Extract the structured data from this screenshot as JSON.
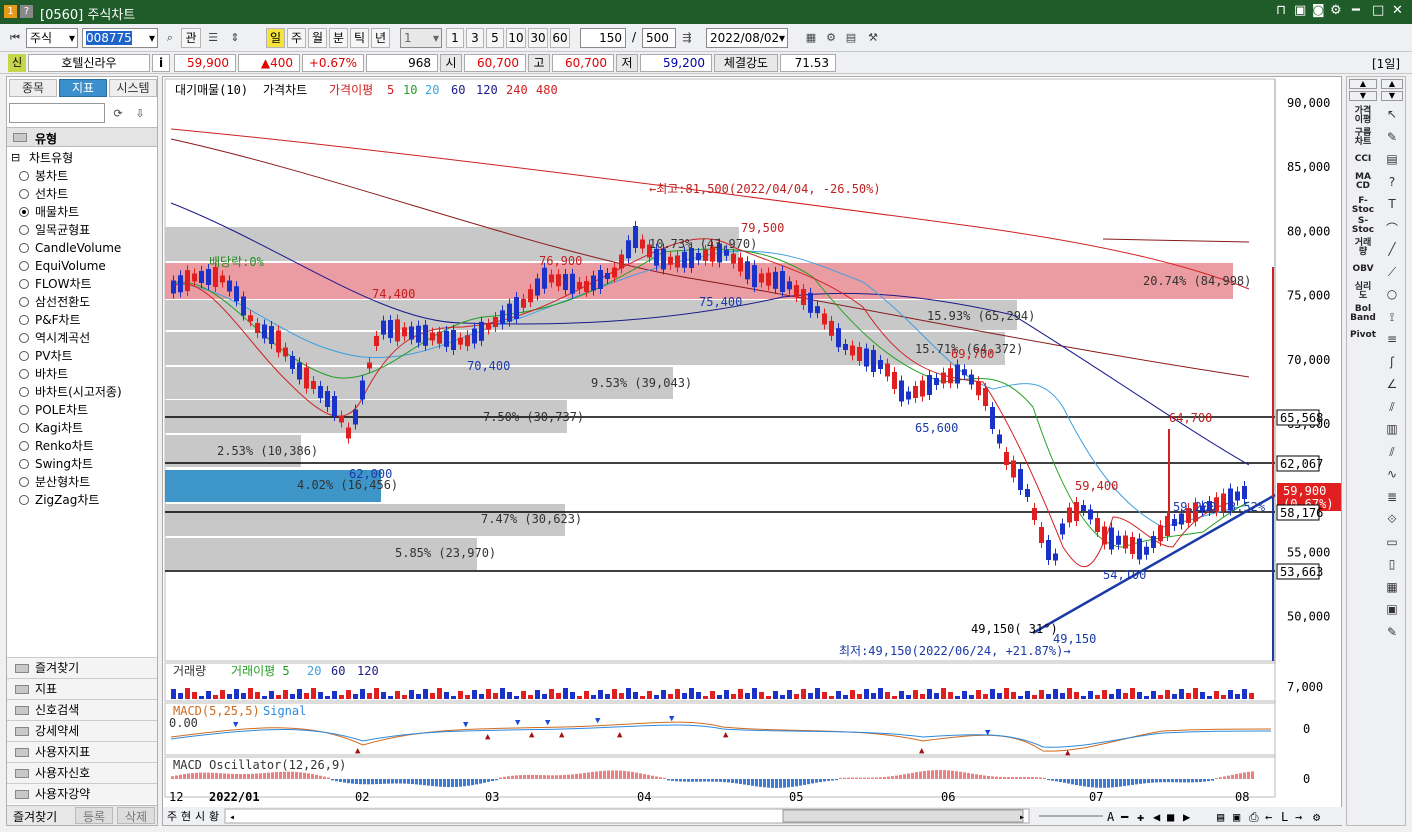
{
  "window": {
    "title": "[0560] 주식차트"
  },
  "toolbar": {
    "market": "주식",
    "code": "008775",
    "btn_gwan": "관",
    "periods": [
      "일",
      "주",
      "월",
      "분",
      "틱",
      "년"
    ],
    "interval": "1",
    "quick": [
      "1",
      "3",
      "5",
      "10",
      "30",
      "60"
    ],
    "count": "150",
    "slash": "/",
    "max": "500",
    "date": "2022/08/02"
  },
  "quote": {
    "badge": "신",
    "name": "호텔신라우",
    "info": "i",
    "price": "59,900",
    "change": "▲400",
    "rate": "+0.67%",
    "volume": "968",
    "open_label": "시",
    "open": "60,700",
    "high_label": "고",
    "high": "60,700",
    "low_label": "저",
    "low": "59,200",
    "strength_label": "체결강도",
    "strength": "71.53",
    "period_tag": "[1일]"
  },
  "left": {
    "tabs": [
      "종목",
      "지표",
      "시스템"
    ],
    "section": "유형",
    "tree_root": "차트유형",
    "types": [
      "봉차트",
      "선차트",
      "매물차트",
      "일목균형표",
      "CandleVolume",
      "EquiVolume",
      "FLOW차트",
      "삼선전환도",
      "P&F차트",
      "역시계곡선",
      "PV차트",
      "바차트",
      "바차트(시고저종)",
      "POLE차트",
      "Kagi차트",
      "Renko차트",
      "Swing차트",
      "분산형차트",
      "ZigZag차트"
    ],
    "selected_type": "매물차트",
    "folders": [
      "즐겨찾기",
      "지표",
      "신호검색",
      "강세약세",
      "사용자지표",
      "사용자신호",
      "사용자강약"
    ],
    "bottom_tabs": [
      "즐겨찾기",
      "등록",
      "삭제"
    ]
  },
  "chart": {
    "legend": {
      "vp": "대기매물(10)",
      "price": "가격차트",
      "ma": "가격이평",
      "ma_periods": [
        "5",
        "10",
        "20",
        "60",
        "120",
        "240",
        "480"
      ]
    },
    "y_labels": [
      "90,000",
      "85,000",
      "80,000",
      "75,000",
      "70,000",
      "65,000",
      "60,000",
      "55,000",
      "50,000"
    ],
    "price_tags": {
      "l1": "65,568",
      "l2": "62,067",
      "current": "59,900",
      "current_pct": "(0.67%)",
      "l3": "58,176",
      "l4": "53,663"
    },
    "vp_labels": [
      "20.74% (84,998)",
      "15.93% (65,294)",
      "15.71% (64,372)",
      "10.73% (43,970)",
      "9.53% (39,043)",
      "7.50% (30,737)",
      "2.53% (10,386)",
      "4.02% (16,456)",
      "7.47% (30,623)",
      "5.85% (23,970)"
    ],
    "annotations": {
      "max": "←최고:81,500(2022/04/04, -26.50%)",
      "min": "최저:49,150(2022/06/24, +21.87%)→",
      "dividend": "배당락:0%",
      "p1": "74,400",
      "p2": "76,900",
      "p3": "79,500",
      "p4": "75,400",
      "p5": "70,400",
      "p6": "62,000",
      "p7": "69,700",
      "p8": "65,600",
      "p9": "64,700",
      "p10": "59,400",
      "p11": "54,100",
      "p12": "49,150",
      "angle": "49,150( 31°)",
      "p13": "59,200",
      "p14": "3.52%"
    },
    "volume": {
      "legend": "거래량",
      "ma_label": "거래이평 5",
      "ma_periods": [
        "20",
        "60",
        "120"
      ],
      "y": "7,000"
    },
    "macd": {
      "legend": "MACD(5,25,5)",
      "signal": "Signal",
      "val": "0.00",
      "y": "0"
    },
    "osc": {
      "legend": "MACD Oscillator(12,26,9)",
      "y": "0"
    },
    "x_labels": [
      "12",
      "2022/01",
      "02",
      "03",
      "04",
      "05",
      "06",
      "07",
      "08"
    ],
    "bottom_buttons": [
      "주",
      "현",
      "시",
      "황"
    ]
  },
  "right": {
    "items": [
      "가격\n이평",
      "구름\n차트",
      "CCI",
      "MA\nCD",
      "F-\nStoc",
      "S-\nStoc",
      "거래\n량",
      "OBV",
      "심리\n도",
      "Bol\nBand",
      "Pivot"
    ]
  }
}
